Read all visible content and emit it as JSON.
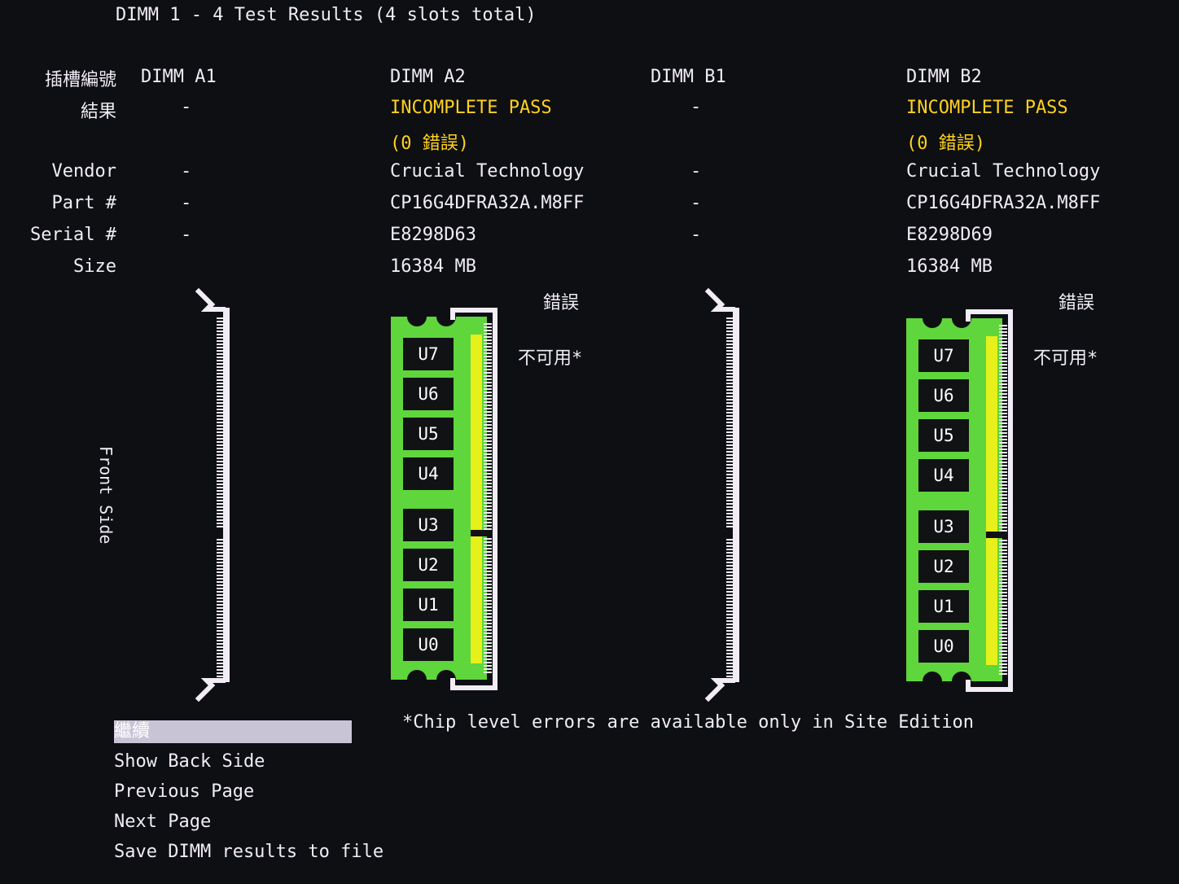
{
  "header": {
    "title": "DIMM 1 - 4 Test Results (4 slots total)"
  },
  "row_labels": {
    "slot": "插槽編號",
    "result": "結果",
    "vendor": "Vendor",
    "part": "Part #",
    "serial": "Serial #",
    "size": "Size"
  },
  "slots": [
    {
      "name": "DIMM A1",
      "result": "-",
      "vendor": "-",
      "part": "-",
      "serial": "-",
      "size": "",
      "populated": false
    },
    {
      "name": "DIMM A2",
      "result": "INCOMPLETE PASS",
      "errors": "(0 錯誤)",
      "vendor": "Crucial Technology",
      "part": "CP16G4DFRA32A.M8FF",
      "serial": "E8298D63",
      "size": "16384 MB",
      "populated": true,
      "error_header": "錯誤",
      "error_value": "不可用*"
    },
    {
      "name": "DIMM B1",
      "result": "-",
      "vendor": "-",
      "part": "-",
      "serial": "-",
      "size": "",
      "populated": false
    },
    {
      "name": "DIMM B2",
      "result": "INCOMPLETE PASS",
      "errors": "(0 錯誤)",
      "vendor": "Crucial Technology",
      "part": "CP16G4DFRA32A.M8FF",
      "serial": "E8298D69",
      "size": "16384 MB",
      "populated": true,
      "error_header": "錯誤",
      "error_value": "不可用*"
    }
  ],
  "chips": [
    "U7",
    "U6",
    "U5",
    "U4",
    "U3",
    "U2",
    "U1",
    "U0"
  ],
  "side_label": "Front Side",
  "footnote": "*Chip level errors are available only in Site Edition",
  "menu": [
    {
      "label": "繼續",
      "selected": true
    },
    {
      "label": "Show Back Side",
      "selected": false
    },
    {
      "label": "Previous Page",
      "selected": false
    },
    {
      "label": "Next Page",
      "selected": false
    },
    {
      "label": "Save DIMM results to file",
      "selected": false
    }
  ],
  "colors": {
    "background": "#0d0f12",
    "text": "#f1ecf5",
    "highlight": "#ffd21e",
    "pcb": "#5fd63c",
    "chip": "#101214",
    "contact_strip": "#e6f01a",
    "menu_selected": "#c9c3d6"
  }
}
